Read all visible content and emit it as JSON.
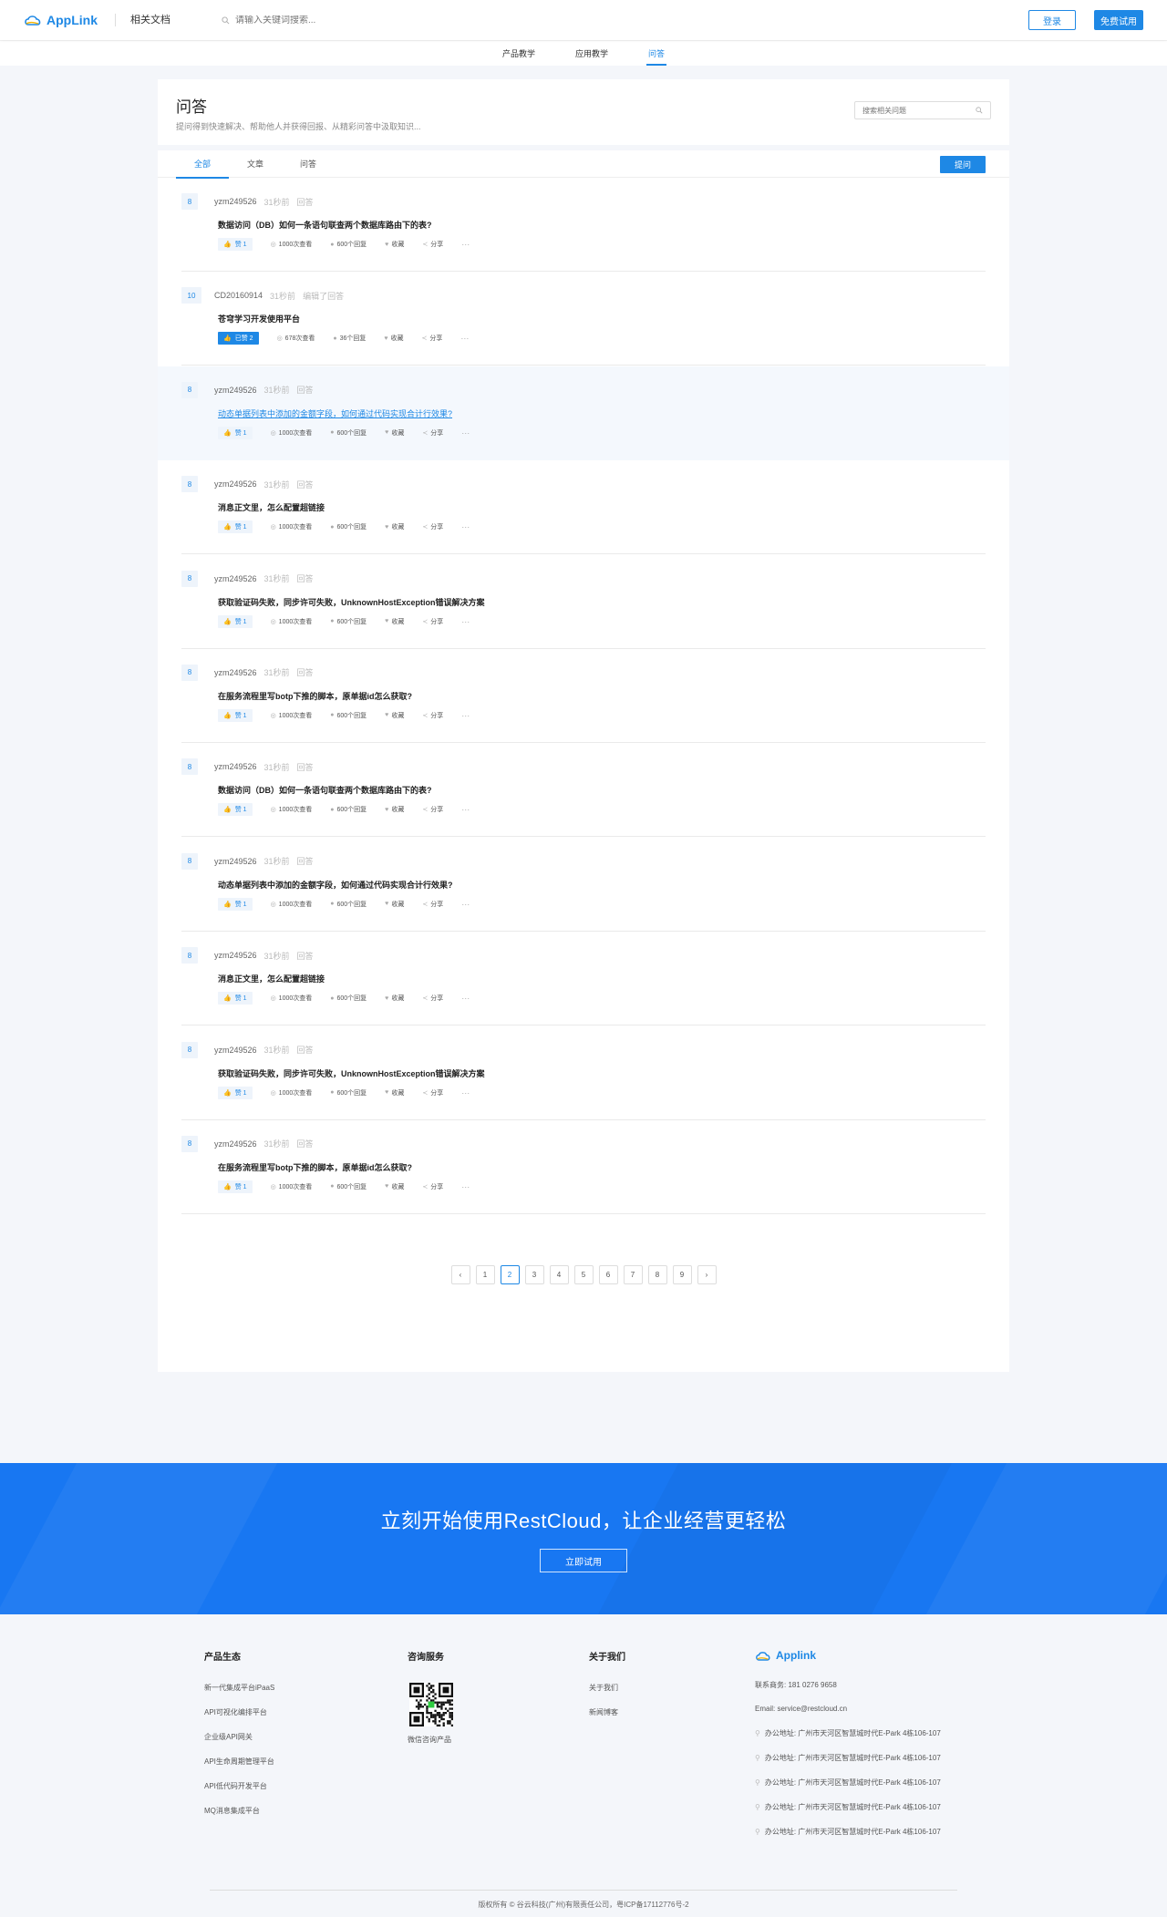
{
  "header": {
    "logo_text": "AppLink",
    "doc_link": "相关文档",
    "search_placeholder": "请输入关键词搜索...",
    "login": "登录",
    "trial": "免费试用"
  },
  "subnav": [
    "产品教学",
    "应用教学",
    "问答"
  ],
  "page": {
    "title": "问答",
    "subtitle": "提问得到快速解决、帮助他人并获得回报、从精彩问答中汲取知识...",
    "search_placeholder": "搜索相关问题"
  },
  "tabs": [
    "全部",
    "文章",
    "问答"
  ],
  "ask_button": "提问",
  "questions": [
    {
      "badge": "8",
      "author": "yzm249526",
      "time": "31秒前",
      "action": "回答",
      "title": "数据访问（DB）如何一条语句联查两个数据库路由下的表?",
      "likes": "赞 1",
      "views": "1000次查看",
      "replies": "600个回复",
      "fav": "收藏",
      "share": "分享",
      "more": "···"
    },
    {
      "badge": "10",
      "author": "CD20160914",
      "time": "31秒前",
      "action": "编辑了回答",
      "title": "苍穹学习开发使用平台",
      "likes": "已赞 2",
      "views": "678次查看",
      "replies": "36个回复",
      "fav": "收藏",
      "share": "分享",
      "more": "···"
    },
    {
      "badge": "8",
      "author": "yzm249526",
      "time": "31秒前",
      "action": "回答",
      "title": "动态单据列表中添加的金额字段，如何通过代码实现合计行效果?",
      "likes": "赞 1",
      "views": "1000次查看",
      "replies": "600个回复",
      "fav": "收藏",
      "share": "分享",
      "more": "···"
    },
    {
      "badge": "8",
      "author": "yzm249526",
      "time": "31秒前",
      "action": "回答",
      "title": "消息正文里，怎么配置超链接",
      "likes": "赞 1",
      "views": "1000次查看",
      "replies": "600个回复",
      "fav": "收藏",
      "share": "分享",
      "more": "···"
    },
    {
      "badge": "8",
      "author": "yzm249526",
      "time": "31秒前",
      "action": "回答",
      "title": "获取验证码失败，同步许可失败，UnknownHostException错误解决方案",
      "likes": "赞 1",
      "views": "1000次查看",
      "replies": "600个回复",
      "fav": "收藏",
      "share": "分享",
      "more": "···"
    },
    {
      "badge": "8",
      "author": "yzm249526",
      "time": "31秒前",
      "action": "回答",
      "title": "在服务流程里写botp下推的脚本，原单据id怎么获取?",
      "likes": "赞 1",
      "views": "1000次查看",
      "replies": "600个回复",
      "fav": "收藏",
      "share": "分享",
      "more": "···"
    },
    {
      "badge": "8",
      "author": "yzm249526",
      "time": "31秒前",
      "action": "回答",
      "title": "数据访问（DB）如何一条语句联查两个数据库路由下的表?",
      "likes": "赞 1",
      "views": "1000次查看",
      "replies": "600个回复",
      "fav": "收藏",
      "share": "分享",
      "more": "···"
    },
    {
      "badge": "8",
      "author": "yzm249526",
      "time": "31秒前",
      "action": "回答",
      "title": "动态单据列表中添加的金额字段，如何通过代码实现合计行效果?",
      "likes": "赞 1",
      "views": "1000次查看",
      "replies": "600个回复",
      "fav": "收藏",
      "share": "分享",
      "more": "···"
    },
    {
      "badge": "8",
      "author": "yzm249526",
      "time": "31秒前",
      "action": "回答",
      "title": "消息正文里，怎么配置超链接",
      "likes": "赞 1",
      "views": "1000次查看",
      "replies": "600个回复",
      "fav": "收藏",
      "share": "分享",
      "more": "···"
    },
    {
      "badge": "8",
      "author": "yzm249526",
      "time": "31秒前",
      "action": "回答",
      "title": "获取验证码失败，同步许可失败，UnknownHostException错误解决方案",
      "likes": "赞 1",
      "views": "1000次查看",
      "replies": "600个回复",
      "fav": "收藏",
      "share": "分享",
      "more": "···"
    },
    {
      "badge": "8",
      "author": "yzm249526",
      "time": "31秒前",
      "action": "回答",
      "title": "在服务流程里写botp下推的脚本，原单据id怎么获取?",
      "likes": "赞 1",
      "views": "1000次查看",
      "replies": "600个回复",
      "fav": "收藏",
      "share": "分享",
      "more": "···"
    }
  ],
  "pagination": {
    "prev": "‹",
    "pages": [
      "1",
      "2",
      "3",
      "4",
      "5",
      "6",
      "7",
      "8",
      "9"
    ],
    "current": "2",
    "next": "›"
  },
  "cta": {
    "title": "立刻开始使用RestCloud，让企业经营更轻松",
    "button": "立即试用"
  },
  "footer": {
    "col1_title": "产品生态",
    "col1_items": [
      "新一代集成平台iPaaS",
      "API可视化编排平台",
      "企业级API网关",
      "API生命周期管理平台",
      "API低代码开发平台",
      "MQ消息集成平台"
    ],
    "col2_title": "咨询服务",
    "qr_label": "微信咨询产品",
    "col3_title": "关于我们",
    "col3_items": [
      "关于我们",
      "新闻博客"
    ],
    "logo_text": "Applink",
    "phone": "联系商务: 181 0276 9658",
    "email": "Email: service@restcloud.cn",
    "addresses": [
      "办公地址: 广州市天河区智慧城时代E-Park 4栋106-107",
      "办公地址: 广州市天河区智慧城时代E-Park 4栋106-107",
      "办公地址: 广州市天河区智慧城时代E-Park 4栋106-107",
      "办公地址: 广州市天河区智慧城时代E-Park 4栋106-107",
      "办公地址: 广州市天河区智慧城时代E-Park 4栋106-107"
    ],
    "copyright": "版权所有 © 谷云科技(广州)有限责任公司，粤ICP备17112776号-2"
  },
  "colors": {
    "accent": "#1e88e5",
    "cta_bg": "#1877f2",
    "page_bg": "#f4f6fa"
  }
}
